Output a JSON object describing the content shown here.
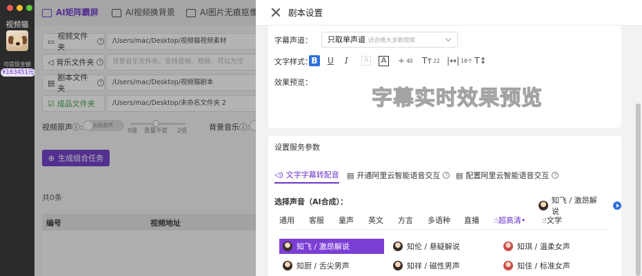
{
  "sidebar": {
    "app_name": "视频猫",
    "withdraw_label": "可提现金额",
    "balance": "¥163451元"
  },
  "main": {
    "tabs": [
      {
        "label": "AI矩阵霸屏",
        "active": true
      },
      {
        "label": "AI视频换背景"
      },
      {
        "label": "AI图片无痕抠像"
      }
    ],
    "fields": [
      {
        "label": "视频文件夹",
        "value": "/Users/mac/Desktop/视频猫视频素材",
        "placeholder": false
      },
      {
        "label": "背乐文件夹",
        "value": "背景音乐文件夹，支持音频、视频，可以为空",
        "placeholder": true
      },
      {
        "label": "剧本文件夹",
        "value": "/Users/mac/Desktop/视频猫剧本",
        "placeholder": false
      },
      {
        "label": "成品文件夹",
        "value": "/Users/mac/Desktop/未命名文件夹 2",
        "placeholder": false
      }
    ],
    "audio": {
      "original_label": "视频原声",
      "original_toggle": "去除原声",
      "zero_label": "0倍",
      "volume_label": "音量不变",
      "two_label": "2倍",
      "bgm_label": "背景音乐"
    },
    "generate_button": "生成组合任务",
    "count_text": "共0条",
    "table_headers": [
      "编号",
      "视频地址"
    ]
  },
  "drawer": {
    "title": "剧本设置",
    "subtitle_channel_label": "字幕声道：",
    "subtitle_channel_value": "只取单声道",
    "subtitle_channel_hint": "适合绝大多数视频",
    "text_style_label": "文字样式：",
    "style_values": {
      "spacing": "40",
      "size": "22",
      "width": "18个"
    },
    "preview_label": "效果预览：",
    "preview_text": "字幕实时效果预览",
    "service_title": "设置服务参数",
    "service_tabs": [
      {
        "label": "文字字幕转配音",
        "active": true
      },
      {
        "label": "开通阿里云智能语音交互"
      },
      {
        "label": "配置阿里云智能语音交互"
      }
    ],
    "voice_select_label": "选择声音（AI合成）：",
    "current_voice": "知飞 / 激昂解说",
    "categories": [
      "通用",
      "客服",
      "童声",
      "英文",
      "方言",
      "多语种",
      "直播",
      "超高清",
      "文学"
    ],
    "active_category": "超高清",
    "voices": [
      {
        "name": "知飞 / 激昂解说",
        "selected": true,
        "gender": "m"
      },
      {
        "name": "知伦 / 悬疑解说",
        "gender": "m"
      },
      {
        "name": "知琪 / 温柔女声",
        "gender": "f"
      },
      {
        "name": "知厨 / 舌尖男声",
        "gender": "m"
      },
      {
        "name": "知祥 / 磁性男声",
        "gender": "m"
      },
      {
        "name": "知佳 / 标准女声",
        "gender": "f"
      }
    ],
    "colors": {
      "accent": "#6b35c8",
      "blue": "#2f6fdd"
    }
  }
}
